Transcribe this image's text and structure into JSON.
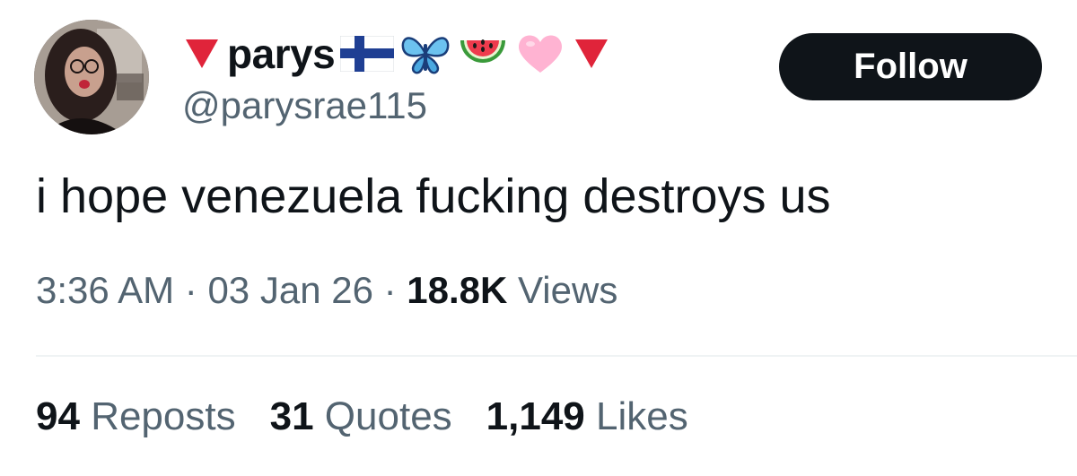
{
  "author": {
    "display_name": "parys",
    "handle": "@parysrae115",
    "name_emojis": [
      "red-triangle-down",
      "finland-flag",
      "butterfly",
      "watermelon",
      "pink-heart",
      "red-triangle-down"
    ]
  },
  "follow_label": "Follow",
  "tweet": {
    "text": "i hope venezuela fucking destroys us",
    "time": "3:36 AM",
    "separator": "·",
    "date": "03 Jan 26",
    "views_count": "18.8K",
    "views_label": "Views"
  },
  "stats": {
    "reposts_count": "94",
    "reposts_label": "Reposts",
    "quotes_count": "31",
    "quotes_label": "Quotes",
    "likes_count": "1,149",
    "likes_label": "Likes"
  },
  "colors": {
    "text_primary": "#0f1419",
    "text_secondary": "#536471",
    "button_bg": "#0f1419",
    "divider": "#eff3f4"
  }
}
